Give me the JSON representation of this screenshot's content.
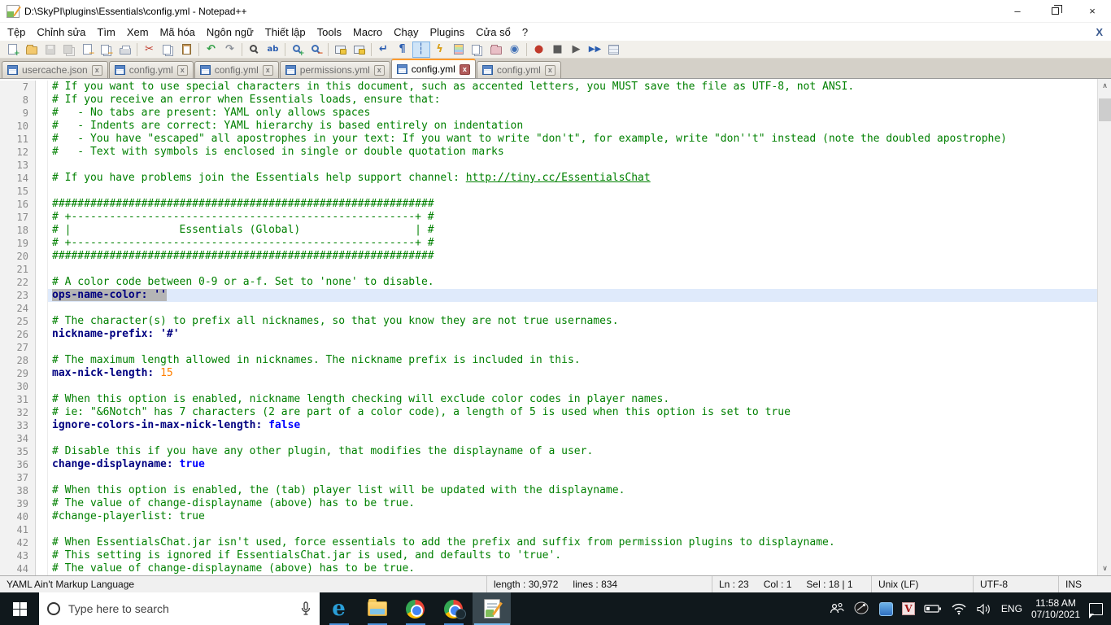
{
  "window": {
    "title": "D:\\SkyPI\\plugins\\Essentials\\config.yml - Notepad++",
    "minimize_glyph": "–",
    "close_glyph": "×"
  },
  "menu": {
    "items": [
      "Tệp",
      "Chỉnh sửa",
      "Tìm",
      "Xem",
      "Mã hóa",
      "Ngôn ngữ",
      "Thiết lập",
      "Tools",
      "Macro",
      "Chạy",
      "Plugins",
      "Cửa sổ",
      "?"
    ],
    "doc_close_label": "X"
  },
  "toolbar": {
    "buttons": [
      {
        "name": "new-file",
        "shape": "s-page",
        "badge": "+",
        "badgeColor": "#2da44e"
      },
      {
        "name": "open-file",
        "shape": "s-folder"
      },
      {
        "name": "save",
        "shape": "s-floppy",
        "disabled": true
      },
      {
        "name": "save-all",
        "shape": "s-floppy2",
        "disabled": true
      },
      {
        "name": "close-file",
        "shape": "s-page",
        "badge": "−",
        "badgeColor": "#e8971e"
      },
      {
        "name": "close-all-files",
        "shape": "s-pages",
        "badge": "−",
        "badgeColor": "#e8971e"
      },
      {
        "name": "print",
        "shape": "s-printer"
      },
      {
        "sep": true
      },
      {
        "name": "cut",
        "glyph": "✂",
        "color": "#c0392b"
      },
      {
        "name": "copy",
        "shape": "s-pages"
      },
      {
        "name": "paste",
        "shape": "s-clipboard"
      },
      {
        "sep": true
      },
      {
        "name": "undo",
        "glyph": "↶",
        "color": "#2f9e44"
      },
      {
        "name": "redo",
        "glyph": "↷",
        "color": "#8a8f98"
      },
      {
        "sep": true
      },
      {
        "name": "find",
        "shape": "s-lens dark"
      },
      {
        "name": "replace",
        "glyph": "ab",
        "color": "#2a5db0",
        "small": true
      },
      {
        "sep": true
      },
      {
        "name": "zoom-in",
        "shape": "s-lens",
        "badge": "+",
        "badgeColor": "#2da44e"
      },
      {
        "name": "zoom-out",
        "shape": "s-lens",
        "badge": "−",
        "badgeColor": "#d9480f"
      },
      {
        "sep": true
      },
      {
        "name": "sync-vertical-scrolling",
        "shape": "s-winlock"
      },
      {
        "name": "sync-horizontal-scrolling",
        "shape": "s-winlock"
      },
      {
        "sep": true
      },
      {
        "name": "word-wrap",
        "glyph": "↵",
        "color": "#2a5db0"
      },
      {
        "name": "show-all-characters",
        "glyph": "¶",
        "color": "#2a5db0"
      },
      {
        "name": "show-indent-guide",
        "glyph": "┆",
        "color": "#2a5db0",
        "active": true
      },
      {
        "name": "function-list",
        "glyph": "ϟ",
        "color": "#d9a018"
      },
      {
        "name": "document-map",
        "shape": "s-docmap"
      },
      {
        "name": "document-switcher",
        "shape": "s-pages"
      },
      {
        "name": "folder-as-workspace",
        "shape": "s-folder pink"
      },
      {
        "name": "monitoring",
        "glyph": "◉",
        "color": "#3f6fb5"
      },
      {
        "sep": true
      },
      {
        "name": "macro-record",
        "glyph": "●",
        "color": "#c0392b"
      },
      {
        "name": "macro-stop",
        "glyph": "■",
        "color": "#5a5a5a"
      },
      {
        "name": "macro-play",
        "glyph": "▶",
        "color": "#5a5a5a"
      },
      {
        "name": "macro-run-multiple",
        "glyph": "▶▶",
        "color": "#2a5db0",
        "small": true
      },
      {
        "name": "macro-save",
        "shape": "s-grid"
      }
    ]
  },
  "tabs": {
    "close_glyph": "x",
    "items": [
      {
        "label": "usercache.json",
        "active": false
      },
      {
        "label": "config.yml",
        "active": false
      },
      {
        "label": "config.yml",
        "active": false
      },
      {
        "label": "permissions.yml",
        "active": false
      },
      {
        "label": "config.yml",
        "active": true
      },
      {
        "label": "config.yml",
        "active": false
      }
    ]
  },
  "editor": {
    "lines": [
      {
        "n": 7,
        "seg": [
          [
            "c",
            "# If you want to use special characters in this document, such as accented letters, you MUST save the file as UTF-8, not ANSI."
          ]
        ]
      },
      {
        "n": 8,
        "seg": [
          [
            "c",
            "# If you receive an error when Essentials loads, ensure that:"
          ]
        ]
      },
      {
        "n": 9,
        "seg": [
          [
            "c",
            "#   - No tabs are present: YAML only allows spaces"
          ]
        ]
      },
      {
        "n": 10,
        "seg": [
          [
            "c",
            "#   - Indents are correct: YAML hierarchy is based entirely on indentation"
          ]
        ]
      },
      {
        "n": 11,
        "seg": [
          [
            "c",
            "#   - You have \"escaped\" all apostrophes in your text: If you want to write \"don't\", for example, write \"don''t\" instead (note the doubled apostrophe)"
          ]
        ]
      },
      {
        "n": 12,
        "seg": [
          [
            "c",
            "#   - Text with symbols is enclosed in single or double quotation marks"
          ]
        ]
      },
      {
        "n": 13,
        "seg": []
      },
      {
        "n": 14,
        "seg": [
          [
            "c",
            "# If you have problems join the Essentials help support channel: "
          ],
          [
            "l",
            "http://tiny.cc/EssentialsChat"
          ]
        ]
      },
      {
        "n": 15,
        "seg": []
      },
      {
        "n": 16,
        "seg": [
          [
            "c",
            "############################################################"
          ]
        ]
      },
      {
        "n": 17,
        "seg": [
          [
            "c",
            "# +------------------------------------------------------+ #"
          ]
        ]
      },
      {
        "n": 18,
        "seg": [
          [
            "c",
            "# |                 Essentials (Global)                  | #"
          ]
        ]
      },
      {
        "n": 19,
        "seg": [
          [
            "c",
            "# +------------------------------------------------------+ #"
          ]
        ]
      },
      {
        "n": 20,
        "seg": [
          [
            "c",
            "############################################################"
          ]
        ]
      },
      {
        "n": 21,
        "seg": []
      },
      {
        "n": 22,
        "seg": [
          [
            "c",
            "# A color code between 0-9 or a-f. Set to 'none' to disable."
          ]
        ]
      },
      {
        "n": 23,
        "caret": true,
        "seg": [
          [
            "k sel",
            "ops-name-color: ''"
          ]
        ]
      },
      {
        "n": 24,
        "seg": []
      },
      {
        "n": 25,
        "seg": [
          [
            "c",
            "# The character(s) to prefix all nicknames, so that you know they are not true usernames."
          ]
        ]
      },
      {
        "n": 26,
        "seg": [
          [
            "k",
            "nickname-prefix: '#'"
          ]
        ]
      },
      {
        "n": 27,
        "seg": []
      },
      {
        "n": 28,
        "seg": [
          [
            "c",
            "# The maximum length allowed in nicknames. The nickname prefix is included in this."
          ]
        ]
      },
      {
        "n": 29,
        "seg": [
          [
            "k",
            "max-nick-length: "
          ],
          [
            "n",
            "15"
          ]
        ]
      },
      {
        "n": 30,
        "seg": []
      },
      {
        "n": 31,
        "seg": [
          [
            "c",
            "# When this option is enabled, nickname length checking will exclude color codes in player names."
          ]
        ]
      },
      {
        "n": 32,
        "seg": [
          [
            "c",
            "# ie: \"&6Notch\" has 7 characters (2 are part of a color code), a length of 5 is used when this option is set to true"
          ]
        ]
      },
      {
        "n": 33,
        "seg": [
          [
            "k",
            "ignore-colors-in-max-nick-length: "
          ],
          [
            "b",
            "false"
          ]
        ]
      },
      {
        "n": 34,
        "seg": []
      },
      {
        "n": 35,
        "seg": [
          [
            "c",
            "# Disable this if you have any other plugin, that modifies the displayname of a user."
          ]
        ]
      },
      {
        "n": 36,
        "seg": [
          [
            "k",
            "change-displayname: "
          ],
          [
            "b",
            "true"
          ]
        ]
      },
      {
        "n": 37,
        "seg": []
      },
      {
        "n": 38,
        "seg": [
          [
            "c",
            "# When this option is enabled, the (tab) player list will be updated with the displayname."
          ]
        ]
      },
      {
        "n": 39,
        "seg": [
          [
            "c",
            "# The value of change-displayname (above) has to be true."
          ]
        ]
      },
      {
        "n": 40,
        "seg": [
          [
            "c",
            "#change-playerlist: true"
          ]
        ]
      },
      {
        "n": 41,
        "seg": []
      },
      {
        "n": 42,
        "seg": [
          [
            "c",
            "# When EssentialsChat.jar isn't used, force essentials to add the prefix and suffix from permission plugins to displayname."
          ]
        ]
      },
      {
        "n": 43,
        "seg": [
          [
            "c",
            "# This setting is ignored if EssentialsChat.jar is used, and defaults to 'true'."
          ]
        ]
      },
      {
        "n": 44,
        "seg": [
          [
            "c",
            "# The value of change-displayname (above) has to be true."
          ]
        ]
      }
    ],
    "scrollbar": {
      "up_glyph": "∧",
      "down_glyph": "∨"
    }
  },
  "statusbar": {
    "doctype": "YAML Ain't Markup Language",
    "length_label": "length : 30,972",
    "lines_label": "lines : 834",
    "ln": "Ln : 23",
    "col": "Col : 1",
    "sel": "Sel : 18 | 1",
    "eol": "Unix (LF)",
    "encoding": "UTF-8",
    "mode": "INS"
  },
  "taskbar": {
    "search_placeholder": "Type here to search",
    "apps": [
      {
        "name": "edge",
        "active": false
      },
      {
        "name": "file-explorer",
        "active": false
      },
      {
        "name": "chrome",
        "active": false
      },
      {
        "name": "chrome-profile",
        "active": false
      },
      {
        "name": "notepad-plus-plus",
        "active": true
      }
    ],
    "language": "ENG",
    "time": "11:58 AM",
    "date": "07/10/2021",
    "v_app_glyph": "V"
  }
}
